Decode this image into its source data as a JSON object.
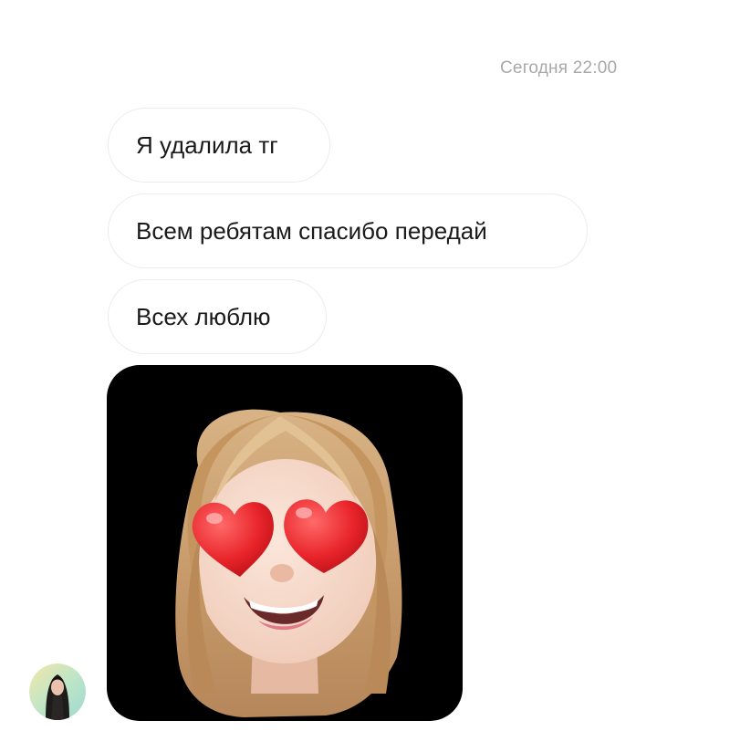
{
  "header": {
    "timestamp": "Сегодня 22:00"
  },
  "messages": [
    {
      "text": "Я удалила тг"
    },
    {
      "text": "Всем ребятам спасибо передай"
    },
    {
      "text": "Всех люблю"
    }
  ],
  "sticker": {
    "icon": "memoji-heart-eyes-icon",
    "background": "#000000"
  },
  "avatar": {
    "icon": "user-avatar-icon"
  },
  "colors": {
    "bubble_border": "#ececec",
    "timestamp_text": "#a8a8a8",
    "message_text": "#1a1a1a"
  }
}
